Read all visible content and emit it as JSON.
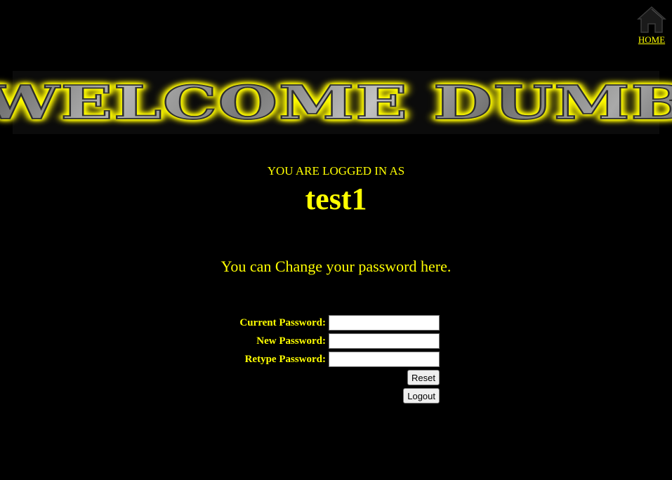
{
  "nav": {
    "home_label": "HOME",
    "home_icon": "home-icon"
  },
  "banner": {
    "title": "WELCOME DUMB"
  },
  "status": {
    "logged_in_label": "YOU ARE LOGGED IN AS",
    "username": "test1"
  },
  "change_password": {
    "heading": "You can Change your password here.",
    "current_label": "Current Password:",
    "current_value": "",
    "new_label": "New Password:",
    "new_value": "",
    "retype_label": "Retype Password:",
    "retype_value": "",
    "reset_label": "Reset",
    "logout_label": "Logout"
  },
  "colors": {
    "background": "#000000",
    "text": "#ffff00",
    "glow": "#ffff00"
  }
}
